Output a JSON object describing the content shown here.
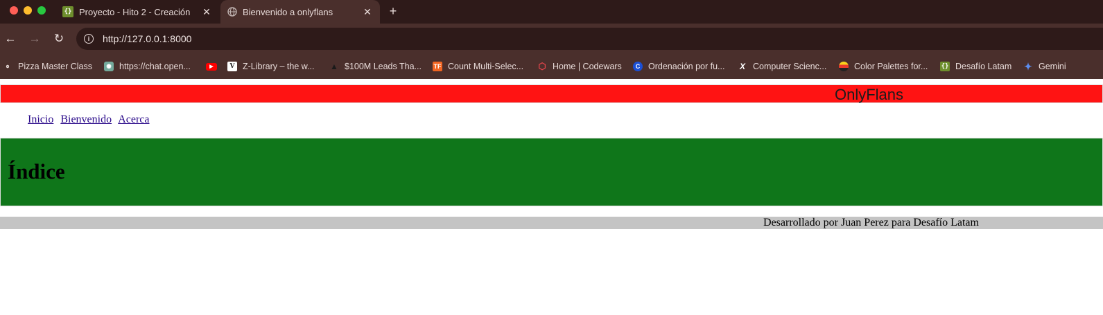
{
  "browser": {
    "tabs": [
      {
        "title": "Proyecto - Hito 2 - Creación",
        "icon": "desafio-latam-icon",
        "active": false
      },
      {
        "title": "Bienvenido a onlyflans",
        "icon": "globe-icon",
        "active": true
      }
    ],
    "new_tab": "+",
    "close": "✕",
    "url": "http://127.0.0.1:8000",
    "bookmarks": [
      {
        "label": "Pizza Master Class",
        "icon": "pizza-icon"
      },
      {
        "label": "https://chat.open...",
        "icon": "chatgpt-icon"
      },
      {
        "label": "",
        "icon": "youtube-icon"
      },
      {
        "label": "Z-Library – the w...",
        "icon": "zlibrary-icon"
      },
      {
        "label": "$100M Leads Tha...",
        "icon": "triangle-icon"
      },
      {
        "label": "Count Multi-Selec...",
        "icon": "tf-icon"
      },
      {
        "label": "Home | Codewars",
        "icon": "codewars-icon"
      },
      {
        "label": "Ordenación por fu...",
        "icon": "c-icon"
      },
      {
        "label": "Computer Scienc...",
        "icon": "x-icon"
      },
      {
        "label": "Color Palettes for...",
        "icon": "palette-icon"
      },
      {
        "label": "Desafío Latam",
        "icon": "desafio-latam-icon"
      },
      {
        "label": "Gemini",
        "icon": "gemini-icon"
      }
    ]
  },
  "page": {
    "header_title": "OnlyFlans",
    "nav": [
      "Inicio",
      "Bienvenido",
      "Acerca"
    ],
    "heading": "Índice",
    "footer": "Desarrollado por Juan Perez para Desafío Latam"
  },
  "colors": {
    "header": "#ff1313",
    "content": "#0f761a",
    "footer": "#c4c4c4",
    "link": "#2a0a8a"
  }
}
